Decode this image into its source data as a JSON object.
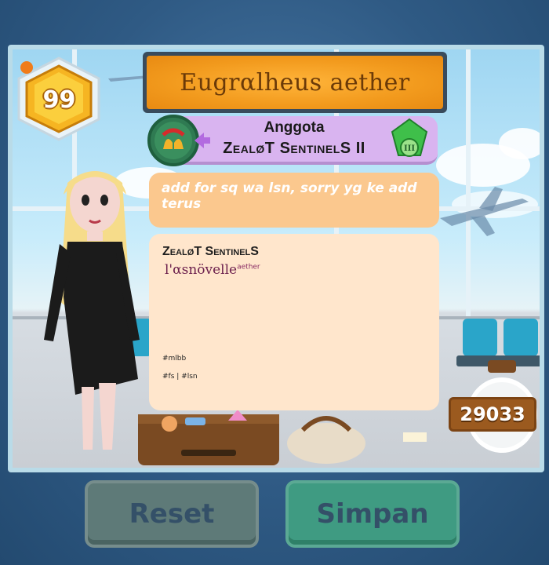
{
  "player": {
    "level": "99",
    "name": "Eugrαlheus aether"
  },
  "guild": {
    "role": "Anggota",
    "name": "ZealøT SentinelS II",
    "emblem_icon": "bells-wreath-icon",
    "rank_icon": "green-gem-rank-3-icon",
    "rank_numeral": "III"
  },
  "bio": {
    "text": "add for sq wa lsn, sorry yg ke add terus"
  },
  "notes": {
    "guild": "ZealøT SentinelS",
    "nickname": "l'αsnövelle",
    "nickname_sup": "aether",
    "tag1": "#mlbb",
    "tag2": "#fs | #lsn"
  },
  "currency": {
    "amount": "29033"
  },
  "buttons": {
    "reset": "Reset",
    "save": "Simpan"
  },
  "colors": {
    "banner": "#f29a1d",
    "guild_bg": "#d9b4f0",
    "bio_bg": "#fbc88e",
    "notes_bg": "#ffe6cc",
    "reset_btn": "#5e7a78",
    "save_btn": "#3f9b82"
  }
}
